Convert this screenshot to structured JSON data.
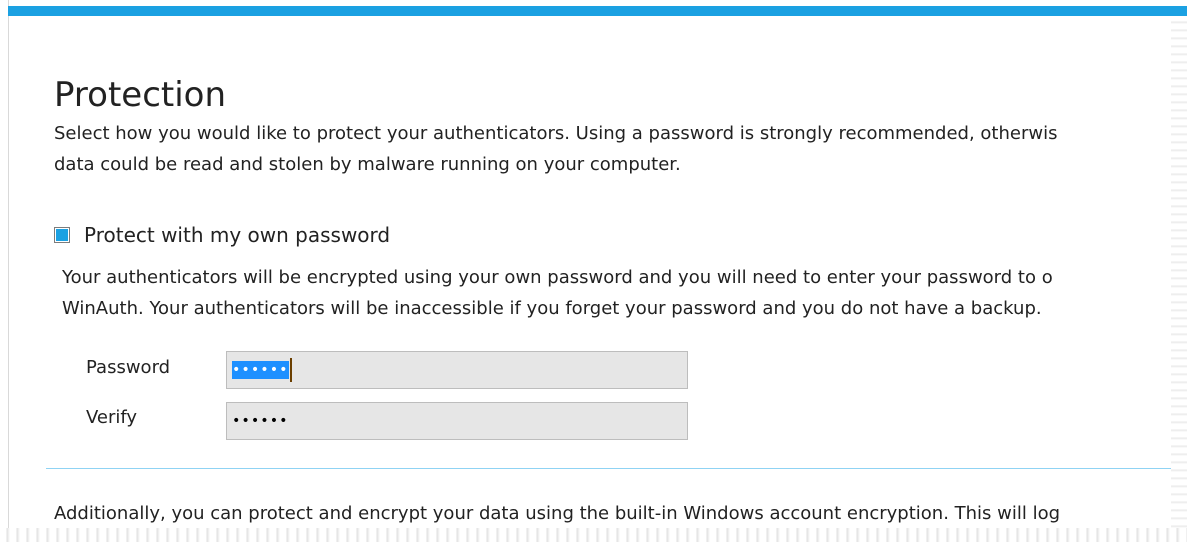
{
  "page": {
    "title": "Protection",
    "intro_lines": [
      "Select how you would like to protect your authenticators. Using a password is strongly recommended, otherwis",
      "data could be read and stolen by malware running on your computer."
    ],
    "password_option": {
      "label": "Protect with my own password",
      "checked": true,
      "description_lines": [
        "Your authenticators will be encrypted using your own password and you will need to enter your password to o",
        "WinAuth. Your authenticators will be inaccessible if you forget your password and you do not have a backup."
      ]
    },
    "fields": {
      "password_label": "Password",
      "password_value": "••••••",
      "verify_label": "Verify",
      "verify_value": "••••••"
    },
    "additional_text": "Additionally, you can protect and encrypt your data using the built-in Windows account encryption. This will log"
  },
  "colors": {
    "accent": "#1ba1e2",
    "selection": "#1e90ff",
    "field_background": "#e6e6e6",
    "divider": "#8fd3f4"
  }
}
